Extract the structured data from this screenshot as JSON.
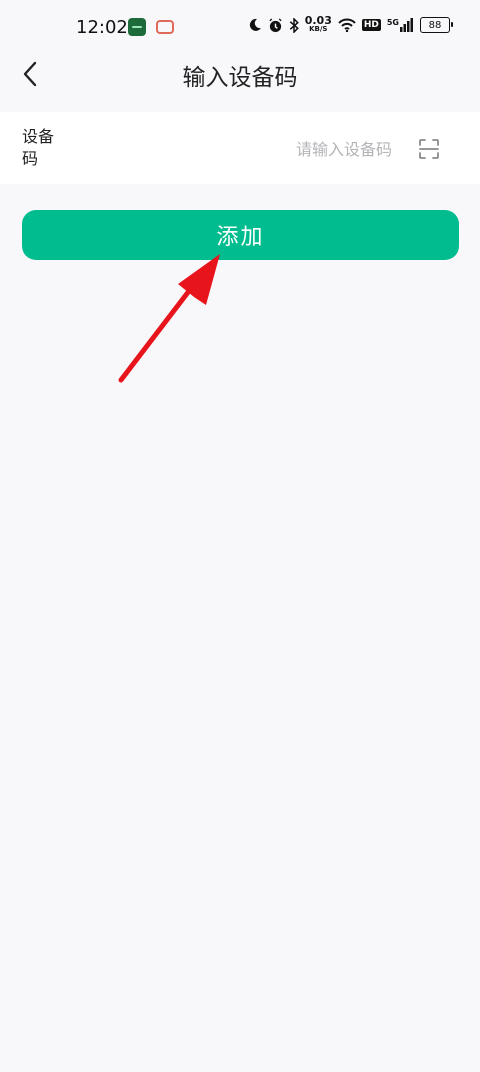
{
  "status_bar": {
    "time": "12:02",
    "net_speed_value": "0.03",
    "net_speed_unit": "KB/S",
    "hd_label": "HD",
    "signal_label": "5G",
    "battery_level": "88"
  },
  "header": {
    "title": "输入设备码"
  },
  "form": {
    "device_code_label": "设备码",
    "device_code_value": "",
    "device_code_placeholder": "请输入设备码"
  },
  "actions": {
    "add_label": "添加"
  },
  "colors": {
    "accent": "#00bc8f",
    "background": "#f8f7fa",
    "annotation": "#e8141c"
  }
}
